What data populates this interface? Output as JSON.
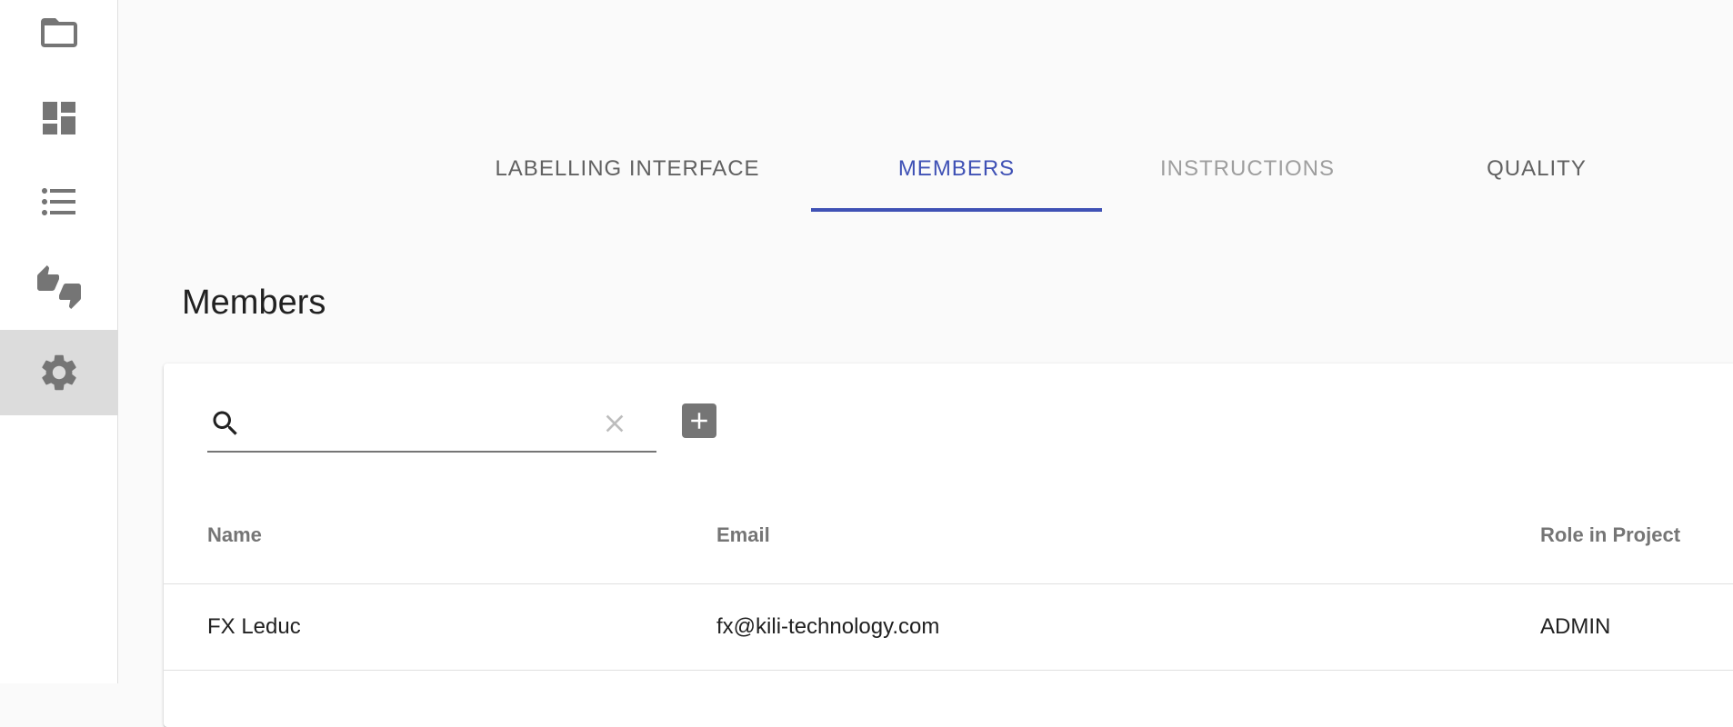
{
  "sidebar": {
    "items": [
      {
        "icon": "folder-icon"
      },
      {
        "icon": "dashboard-icon"
      },
      {
        "icon": "list-icon"
      },
      {
        "icon": "thumbs-up-down-icon"
      },
      {
        "icon": "settings-gear-icon",
        "active": true
      }
    ]
  },
  "tabs": [
    {
      "label": "LABELLING INTERFACE",
      "state": "normal"
    },
    {
      "label": "MEMBERS",
      "state": "active"
    },
    {
      "label": "INSTRUCTIONS",
      "state": "disabled"
    },
    {
      "label": "QUALITY",
      "state": "normal"
    }
  ],
  "page": {
    "title": "Members"
  },
  "search": {
    "value": "",
    "placeholder": ""
  },
  "table": {
    "columns": [
      "Name",
      "Email",
      "Role in Project"
    ],
    "rows": [
      {
        "name": "FX Leduc",
        "email": "fx@kili-technology.com",
        "role": "ADMIN"
      }
    ]
  },
  "colors": {
    "accent": "#3f51b5",
    "sidebar_active_bg": "#dcdcdc",
    "icon_gray": "#757575"
  }
}
